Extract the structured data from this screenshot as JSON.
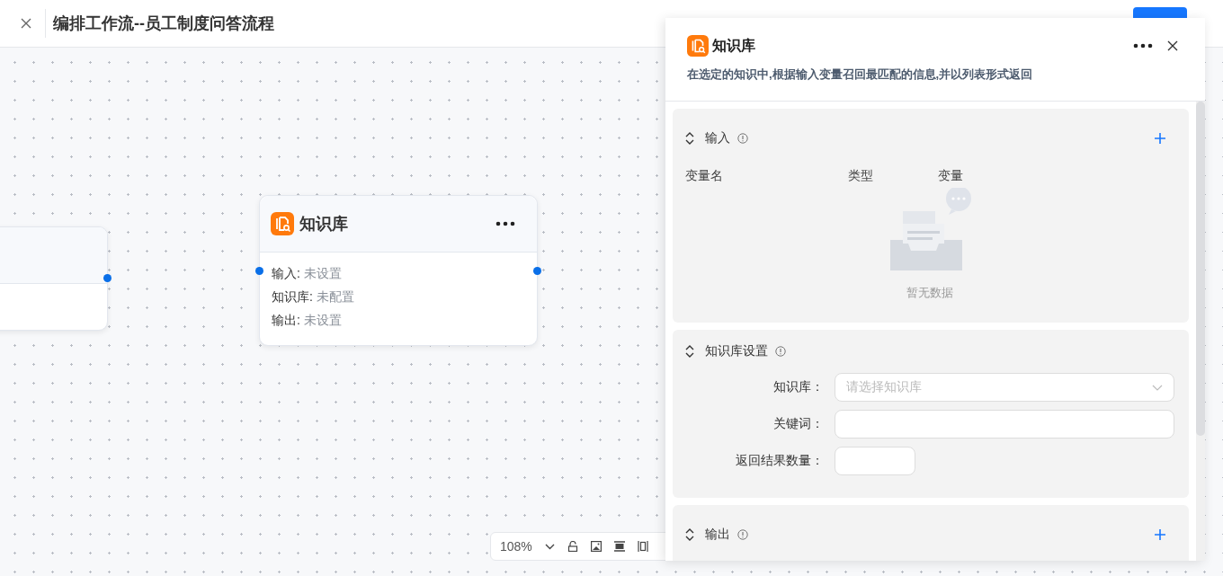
{
  "header": {
    "title": "编排工作流--员工制度问答流程"
  },
  "node": {
    "title": "知识库",
    "rows": [
      {
        "label": "输入:",
        "value": "未设置"
      },
      {
        "label": "知识库:",
        "value": "未配置"
      },
      {
        "label": "输出:",
        "value": "未设置"
      }
    ]
  },
  "zoom_toolbar": {
    "zoom": "108%"
  },
  "panel": {
    "title": "知识库",
    "description": "在选定的知识中,根据输入变量召回最匹配的信息,并以列表形式返回",
    "sections": [
      {
        "kind": "table",
        "title": "输入",
        "addable": true,
        "columns": [
          "变量名",
          "类型",
          "变量"
        ],
        "empty_text": "暂无数据"
      },
      {
        "kind": "form",
        "title": "知识库设置",
        "addable": false,
        "fields": [
          {
            "kind": "select",
            "label": "知识库：",
            "placeholder": "请选择知识库"
          },
          {
            "kind": "input",
            "label": "关键词："
          },
          {
            "kind": "number",
            "label": "返回结果数量："
          }
        ]
      },
      {
        "kind": "table",
        "title": "输出",
        "addable": true
      }
    ]
  }
}
